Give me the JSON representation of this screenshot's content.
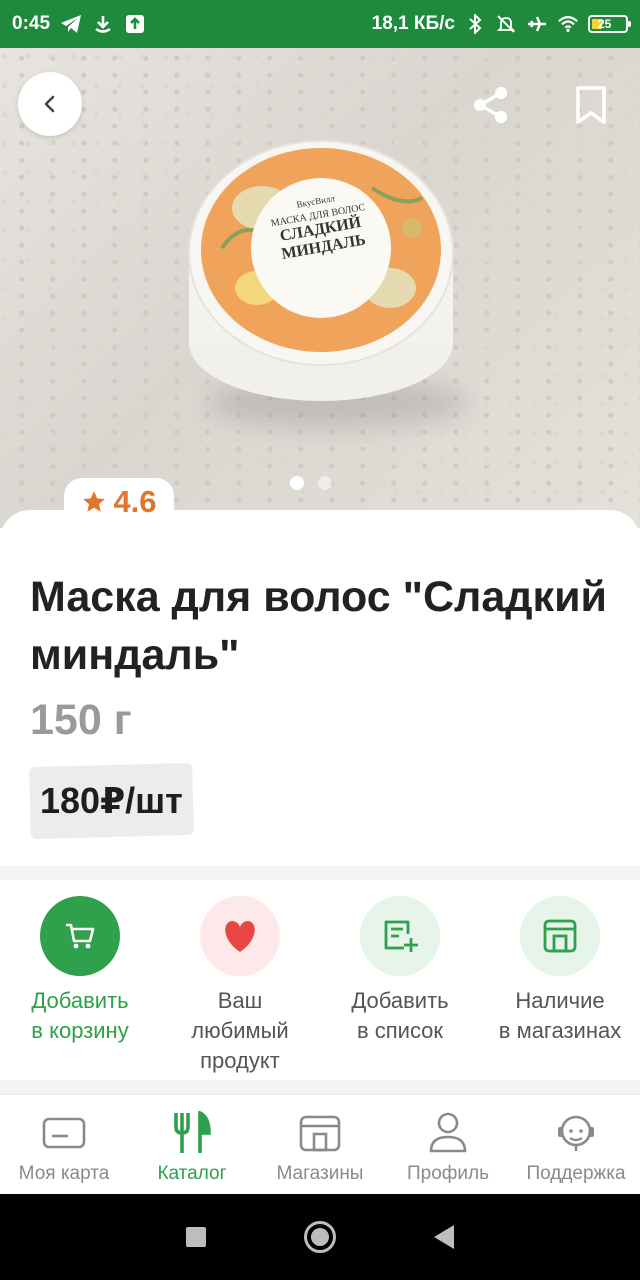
{
  "status_bar": {
    "time": "0:45",
    "network_speed": "18,1 КБ/с",
    "battery": "25",
    "icons": [
      "telegram-icon",
      "download-icon",
      "upload-icon",
      "bluetooth-icon",
      "mute-icon",
      "airplane-icon",
      "wifi-icon",
      "battery-icon"
    ]
  },
  "hero": {
    "carousel_count": 2,
    "carousel_active": 0,
    "jar_label": {
      "brand": "ВкусВилл",
      "line1": "МАСКА ДЛЯ ВОЛОС",
      "line2": "СЛАДКИЙ",
      "line3": "МИНДАЛЬ"
    }
  },
  "product": {
    "rating": "4.6",
    "title": "Маска для волос \"Сладкий миндаль\"",
    "weight": "150 г",
    "price": "180₽/шт"
  },
  "actions": [
    {
      "label": "Добавить\nв корзину",
      "icon": "cart-icon"
    },
    {
      "label": "Ваш\nлюбимый\nпродукт",
      "icon": "heart-icon"
    },
    {
      "label": "Добавить\nв список",
      "icon": "add-to-list-icon"
    },
    {
      "label": "Наличие\nв магазинах",
      "icon": "store-icon"
    }
  ],
  "bottom_nav": [
    {
      "label": "Моя карта",
      "icon": "card-icon"
    },
    {
      "label": "Каталог",
      "icon": "cutlery-icon",
      "active": true
    },
    {
      "label": "Магазины",
      "icon": "store-icon"
    },
    {
      "label": "Профиль",
      "icon": "profile-icon"
    },
    {
      "label": "Поддержка",
      "icon": "support-icon"
    }
  ],
  "colors": {
    "brand_green": "#2fa04b",
    "status_green": "#1f8a3c",
    "rating_orange": "#e0762a",
    "heart_red": "#e84545"
  }
}
